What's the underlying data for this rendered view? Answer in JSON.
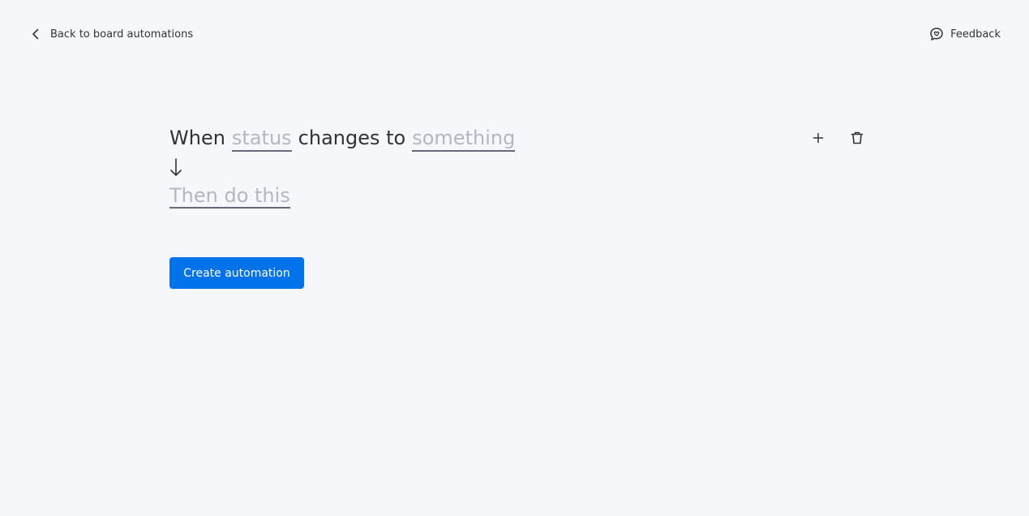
{
  "header": {
    "back_label": "Back to board automations",
    "feedback_label": "Feedback"
  },
  "recipe": {
    "when_text": "When",
    "trigger_field": "status",
    "changes_text": "changes to",
    "trigger_value": "something",
    "action_placeholder": "Then do this"
  },
  "actions": {
    "create_label": "Create automation"
  },
  "icons": {
    "back": "chevron-left-icon",
    "feedback": "feedback-bubble-icon",
    "add": "plus-icon",
    "delete": "trash-icon",
    "flow": "arrow-down-icon"
  },
  "colors": {
    "background": "#f6f7fb",
    "primary": "#0073ea",
    "text": "#323338",
    "placeholder": "#b4b6c2",
    "underline": "#676879"
  }
}
